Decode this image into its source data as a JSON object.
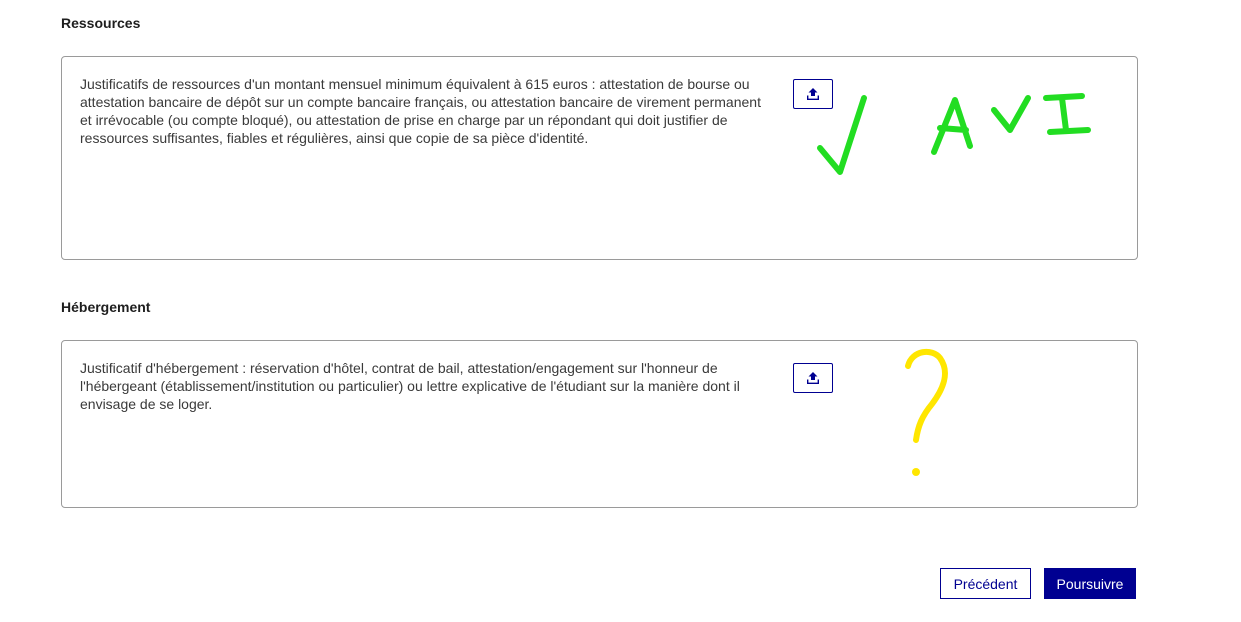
{
  "sections": {
    "ressources": {
      "title": "Ressources",
      "description": "Justificatifs de ressources d'un montant mensuel minimum équivalent à 615 euros : attestation de bourse ou attestation bancaire de dépôt sur un compte bancaire français, ou attestation bancaire de virement permanent et irrévocable (ou compte bloqué), ou attestation de prise en charge par un répondant qui doit justifier de ressources suffisantes, fiables et régulières, ainsi que copie de sa pièce d'identité.",
      "upload_icon": "upload-icon",
      "annotation": {
        "text": "AVI",
        "checkmark": "checkmark",
        "color": "#22dd22"
      }
    },
    "hebergement": {
      "title": "Hébergement",
      "description": "Justificatif d'hébergement : réservation d'hôtel, contrat de bail, attestation/engagement sur l'honneur de l'hébergeant (établissement/institution ou particulier) ou lettre explicative de l'étudiant sur la manière dont il envisage de se loger.",
      "upload_icon": "upload-icon",
      "annotation": {
        "symbol": "?",
        "color": "#ffe600"
      }
    }
  },
  "footer": {
    "previous_label": "Précédent",
    "continue_label": "Poursuivre"
  },
  "colors": {
    "primary": "#000091",
    "border": "#9a9a9a",
    "text": "#3a3a3a"
  }
}
